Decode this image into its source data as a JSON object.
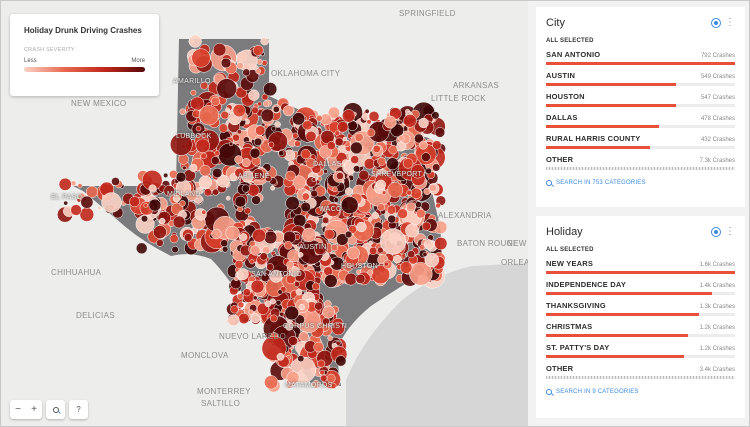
{
  "legend": {
    "title": "Holiday Drunk Driving Crashes",
    "subtitle": "CRASH SEVERITY",
    "low_label": "Less",
    "high_label": "More",
    "gradient": [
      "#fbd2c4",
      "#e8694f",
      "#c0271b",
      "#5a0a0a"
    ]
  },
  "map": {
    "labels": [
      {
        "text": "SPRINGFIELD",
        "cls": "dark"
      },
      {
        "text": "OKLAHOMA CITY",
        "cls": "large"
      },
      {
        "text": "ARKANSAS",
        "cls": "large"
      },
      {
        "text": "NEW MEXICO",
        "cls": "large"
      },
      {
        "text": "LITTLE ROCK",
        "cls": "dark"
      },
      {
        "text": "AMARILLO",
        "cls": "light"
      },
      {
        "text": "LUBBOCK",
        "cls": "light"
      },
      {
        "text": "DALLAS",
        "cls": "light"
      },
      {
        "text": "SHREVEPORT",
        "cls": "light"
      },
      {
        "text": "ABILENE",
        "cls": "light"
      },
      {
        "text": "MIDLAND",
        "cls": "light"
      },
      {
        "text": "EL PASO",
        "cls": "light"
      },
      {
        "text": "WACO",
        "cls": "light"
      },
      {
        "text": "ALEXANDRIA",
        "cls": "dark"
      },
      {
        "text": "AUSTIN",
        "cls": "light"
      },
      {
        "text": "BATON ROUGE",
        "cls": "dark"
      },
      {
        "text": "NEW",
        "cls": "dark"
      },
      {
        "text": "ORLEA",
        "cls": "large"
      },
      {
        "text": "HOUSTON",
        "cls": "light"
      },
      {
        "text": "SAN ANTONIO",
        "cls": "light"
      },
      {
        "text": "CHIHUAHUA",
        "cls": "dark"
      },
      {
        "text": "DELICIAS",
        "cls": "dark"
      },
      {
        "text": "NUEVO LAREDO",
        "cls": "dark"
      },
      {
        "text": "CORPUS CHRISTI",
        "cls": "light"
      },
      {
        "text": "MONCLOVA",
        "cls": "dark"
      },
      {
        "text": "MONTERREY",
        "cls": "large"
      },
      {
        "text": "SALTILLO",
        "cls": "dark"
      },
      {
        "text": "MATAMOROS",
        "cls": "light"
      }
    ],
    "colors": {
      "background": "#ededec",
      "state": "#7b7b7d",
      "water": "#d6d6d6"
    }
  },
  "controls": {
    "zoom_out": "−",
    "zoom_in": "+",
    "search_icon": "search-icon",
    "help": "?"
  },
  "widgets": {
    "city": {
      "title": "City",
      "all_selected": "ALL SELECTED",
      "rows": [
        {
          "name": "SAN ANTONIO",
          "count": "792 Crashes",
          "fraction": 1.0
        },
        {
          "name": "AUSTIN",
          "count": "549 Crashes",
          "fraction": 0.69
        },
        {
          "name": "HOUSTON",
          "count": "547 Crashes",
          "fraction": 0.69
        },
        {
          "name": "DALLAS",
          "count": "478 Crashes",
          "fraction": 0.6
        },
        {
          "name": "RURAL HARRIS COUNTY",
          "count": "432 Crashes",
          "fraction": 0.55
        },
        {
          "name": "OTHER",
          "count": "7.3k Crashes",
          "fraction": 1.0
        }
      ],
      "search": "SEARCH IN 753 CATEGORIES"
    },
    "holiday": {
      "title": "Holiday",
      "all_selected": "ALL SELECTED",
      "rows": [
        {
          "name": "NEW YEARS",
          "count": "1.6k Crashes",
          "fraction": 1.0
        },
        {
          "name": "INDEPENDENCE DAY",
          "count": "1.4k Crashes",
          "fraction": 0.88
        },
        {
          "name": "THANKSGIVING",
          "count": "1.3k Crashes",
          "fraction": 0.81
        },
        {
          "name": "CHRISTMAS",
          "count": "1.2k Crashes",
          "fraction": 0.75
        },
        {
          "name": "ST. PATTY'S DAY",
          "count": "1.2k Crashes",
          "fraction": 0.73
        },
        {
          "name": "OTHER",
          "count": "3.4k Crashes",
          "fraction": 1.0
        }
      ],
      "search": "SEARCH IN 9 CATEGORIES"
    }
  }
}
